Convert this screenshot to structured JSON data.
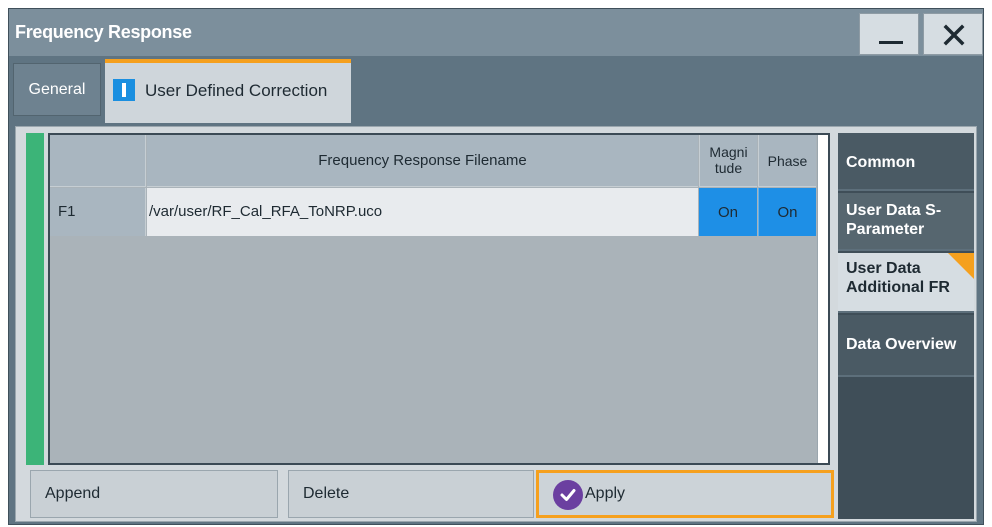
{
  "window": {
    "title": "Frequency Response",
    "controls": {
      "minimize": "minimize-icon",
      "close": "close-icon"
    }
  },
  "tabs": [
    {
      "label": "General",
      "active": false
    },
    {
      "label": "User Defined Correction",
      "active": true
    }
  ],
  "table": {
    "headers": {
      "id": "",
      "filename": "Frequency Response Filename",
      "magnitude": "Magni\ntude",
      "phase": "Phase"
    },
    "rows": [
      {
        "id": "F1",
        "filename": "/var/user/RF_Cal_RFA_ToNRP.uco",
        "magnitude": "On",
        "phase": "On"
      }
    ]
  },
  "buttons": {
    "append": "Append",
    "delete": "Delete",
    "apply": "Apply"
  },
  "side_nav": {
    "items": [
      {
        "label": "Common"
      },
      {
        "label": "User Data S-Parameter"
      },
      {
        "label": "User Data Additional FR",
        "active": true
      },
      {
        "label": "Data Overview"
      }
    ]
  },
  "colors": {
    "accent": "#f5a01e",
    "selected_cell": "#1e8fe6",
    "status_strip": "#3cb478",
    "apply_icon": "#6b3fa0"
  }
}
